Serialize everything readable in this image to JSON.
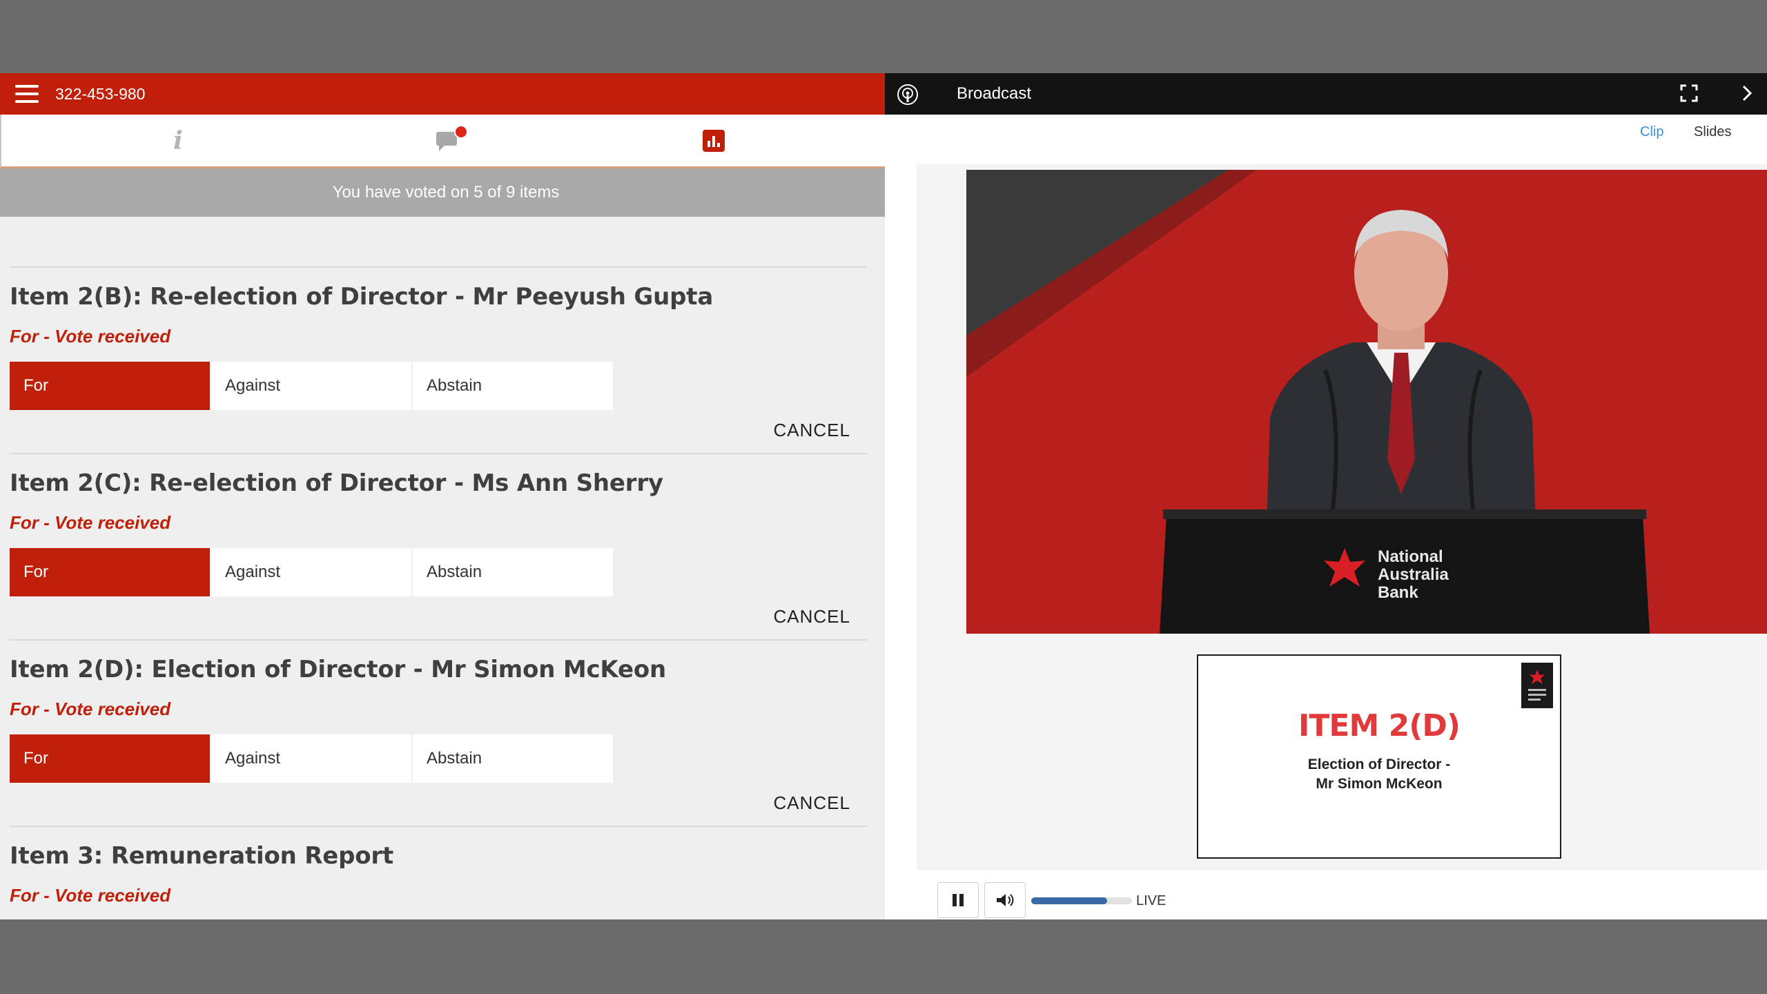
{
  "header": {
    "meeting_id": "322-453-980"
  },
  "tabs": [
    {
      "name": "info",
      "icon": "info-icon",
      "active": false
    },
    {
      "name": "messages",
      "icon": "chat-icon",
      "active": false,
      "has_notification": true
    },
    {
      "name": "voting",
      "icon": "bar-chart-icon",
      "active": true
    }
  ],
  "progress_banner": "You have voted on 5 of 9 items",
  "vote_options": [
    "For",
    "Against",
    "Abstain"
  ],
  "cancel_label": "CANCEL",
  "items": [
    {
      "title": "Item 2(B): Re-election of Director - Mr Peeyush Gupta",
      "status": "For - Vote received",
      "selected": "For"
    },
    {
      "title": "Item 2(C): Re-election of Director - Ms Ann Sherry",
      "status": "For - Vote received",
      "selected": "For"
    },
    {
      "title": "Item 2(D): Election of Director - Mr Simon McKeon",
      "status": "For - Vote received",
      "selected": "For"
    },
    {
      "title": "Item 3: Remuneration Report",
      "status": "For - Vote received",
      "selected": "For"
    }
  ],
  "broadcast": {
    "title": "Broadcast",
    "view_tabs": {
      "clip": "Clip",
      "slides": "Slides"
    },
    "active_view": "clip",
    "podium_brand": {
      "line1": "National",
      "line2": "Australia",
      "line3": "Bank"
    },
    "slide": {
      "heading": "ITEM 2(D)",
      "line1": "Election of Director -",
      "line2": "Mr Simon McKeon"
    },
    "player": {
      "live_label": "LIVE",
      "volume_level": 0.75,
      "state": "playing"
    }
  },
  "colors": {
    "brand_red": "#c0200a",
    "link_blue": "#3a8fd8",
    "volume_blue": "#3a6aa6"
  }
}
